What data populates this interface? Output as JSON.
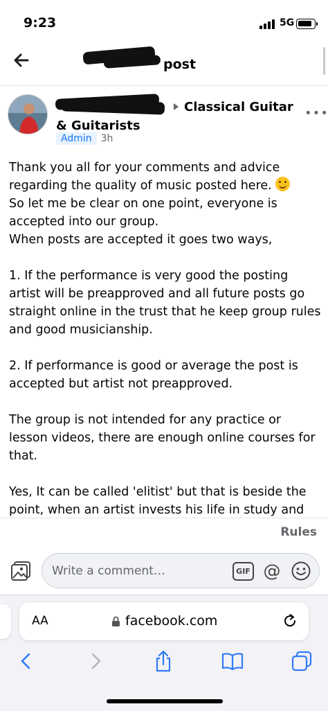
{
  "status": {
    "time": "9:23",
    "network": "5G"
  },
  "header": {
    "title": "post",
    "back_icon": "back-arrow-icon"
  },
  "post": {
    "group_name": "Classical Guitar & Guitarists",
    "badge": "Admin",
    "time": "3h",
    "more_label": "•••",
    "paragraphs": [
      "Thank you all for your comments and advice regarding the quality of music posted here. ",
      "So let me be clear on one point, everyone is accepted into our group.",
      "When posts are accepted it goes two ways,",
      "",
      "1. If the performance is very good the posting artist will be preapproved and all future posts go straight online in the trust that he keep group rules and good musicianship.",
      "",
      "2. If performance is good or average the post is accepted but artist not preapproved.",
      "",
      "The group is not intended for any practice or lesson videos, there are enough online courses for that.",
      "",
      "Yes, It can be called 'elitist' but that is beside the",
      "point, when an artist invests his life in study and"
    ]
  },
  "rules_label": "Rules",
  "comment": {
    "placeholder": "Write a comment…",
    "gif_label": "GIF",
    "at_label": "@"
  },
  "browser": {
    "aa_label": "AA",
    "url": "facebook.com"
  },
  "colors": {
    "accent": "#1877f2",
    "muted": "#65676b",
    "badge_bg": "#e7f3ff"
  }
}
